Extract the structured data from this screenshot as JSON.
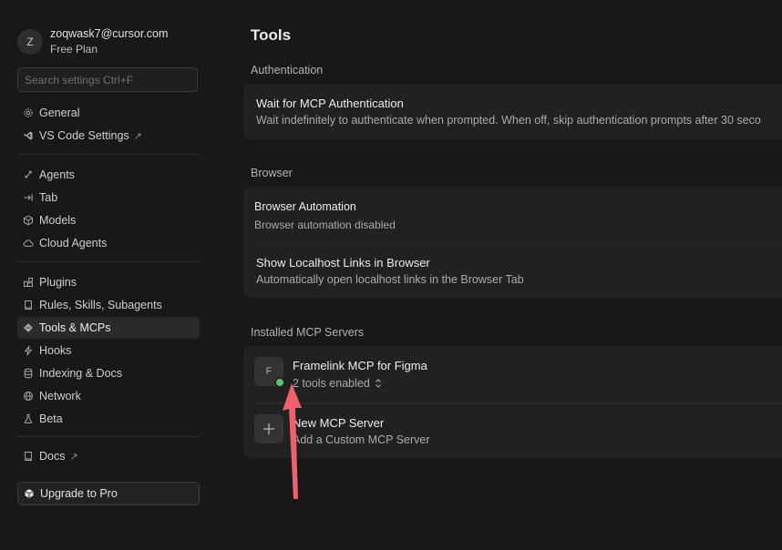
{
  "sidebar": {
    "profile": {
      "initial": "Z",
      "email": "zoqwask7@cursor.com",
      "plan": "Free Plan"
    },
    "search": {
      "placeholder": "Search settings Ctrl+F",
      "value": ""
    },
    "items": [
      {
        "label": "General",
        "icon": "gear-icon"
      },
      {
        "label": "VS Code Settings",
        "icon": "vscode-icon",
        "external": "↗"
      },
      {
        "label": "Agents",
        "icon": "agents-icon"
      },
      {
        "label": "Tab",
        "icon": "tab-icon"
      },
      {
        "label": "Models",
        "icon": "cube-icon"
      },
      {
        "label": "Cloud Agents",
        "icon": "cloud-icon"
      },
      {
        "label": "Plugins",
        "icon": "plugins-icon"
      },
      {
        "label": "Rules, Skills, Subagents",
        "icon": "book-icon"
      },
      {
        "label": "Tools & MCPs",
        "icon": "tools-icon",
        "active": true
      },
      {
        "label": "Hooks",
        "icon": "bolt-icon"
      },
      {
        "label": "Indexing & Docs",
        "icon": "database-icon"
      },
      {
        "label": "Network",
        "icon": "globe-icon"
      },
      {
        "label": "Beta",
        "icon": "flask-icon"
      },
      {
        "label": "Docs",
        "icon": "docs-icon",
        "external": "↗"
      }
    ],
    "upgrade_label": "Upgrade to Pro"
  },
  "main": {
    "title": "Tools",
    "authentication": {
      "label": "Authentication",
      "rows": [
        {
          "title": "Wait for MCP Authentication",
          "desc": "Wait indefinitely to authenticate when prompted. When off, skip authentication prompts after 30 seco"
        }
      ]
    },
    "browser": {
      "label": "Browser",
      "rows": [
        {
          "title": "Browser Automation",
          "desc": "Browser automation disabled"
        },
        {
          "title": "Show Localhost Links in Browser",
          "desc": "Automatically open localhost links in the Browser Tab"
        }
      ]
    },
    "mcp": {
      "label": "Installed MCP Servers",
      "servers": [
        {
          "initial": "F",
          "name": "Framelink MCP for Figma",
          "tools": "2 tools enabled",
          "status": "connected"
        }
      ],
      "new_server": {
        "title": "New MCP Server",
        "desc": "Add a Custom MCP Server",
        "icon": "plus-icon"
      }
    }
  },
  "colors": {
    "background": "#181818",
    "card": "#212121",
    "status_ok": "#5fbf6b",
    "annotation_arrow": "#f0606a"
  }
}
